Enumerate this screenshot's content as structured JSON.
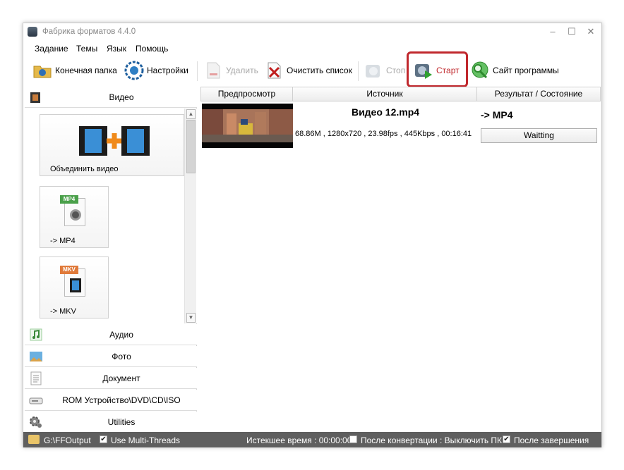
{
  "window": {
    "title": "Фабрика форматов 4.4.0",
    "minimize": "–",
    "maximize": "☐",
    "close": "✕"
  },
  "menu": [
    "Задание",
    "Темы",
    "Язык",
    "Помощь"
  ],
  "toolbar": {
    "output_folder": "Конечная папка",
    "settings": "Настройки",
    "delete": "Удалить",
    "clear_list": "Очистить список",
    "stop": "Стоп",
    "start": "Старт",
    "website": "Сайт программы"
  },
  "sidebar": {
    "video": "Видео",
    "tiles": [
      "Объединить видео",
      "-> MP4",
      "-> MKV"
    ],
    "tile_badges": [
      "MP4",
      "MKV"
    ],
    "audio": "Аудио",
    "photo": "Фото",
    "document": "Документ",
    "rom": "ROM Устройство\\DVD\\CD\\ISO",
    "utilities": "Utilities"
  },
  "table": {
    "headers": [
      "Предпросмотр",
      "Источник",
      "Результат / Состояние"
    ],
    "rows": [
      {
        "source_title": "Видео 12.mp4",
        "source_info": "68.86M , 1280x720 , 23.98fps , 445Kbps , 00:16:41",
        "result": "-> MP4",
        "status": "Waitting"
      }
    ]
  },
  "statusbar": {
    "output_path": "G:\\FFOutput",
    "multithread": "Use Multi-Threads",
    "elapsed": "Истекшее время : 00:00:00",
    "after_convert": "После конвертации : Выключить ПК",
    "after_done": "После завершения"
  },
  "colors": {
    "highlight": "#c0282d",
    "status_bar": "#5f5f5f",
    "start_label": "#c0282d"
  }
}
